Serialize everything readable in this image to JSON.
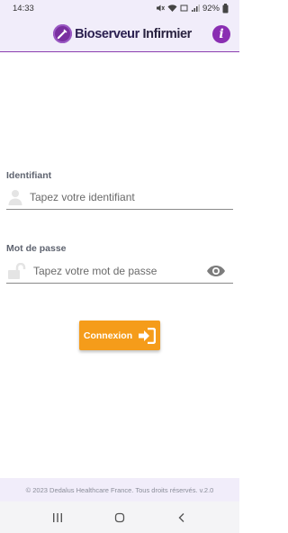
{
  "status_bar": {
    "time": "14:33",
    "battery": "92%",
    "icons": [
      "mute-icon",
      "wifi-icon",
      "volte-icon",
      "signal-icon",
      "battery-icon"
    ]
  },
  "header": {
    "brand_first": "Bioserveur",
    "brand_second": " Infirmier",
    "logo_icon": "syringe-logo-icon",
    "info_label": "i",
    "accent_color": "#8a2eb2"
  },
  "form": {
    "username_label": "Identifiant",
    "username_placeholder": "Tapez votre identifiant",
    "username_value": "",
    "password_label": "Mot de passe",
    "password_placeholder": "Tapez votre mot de passe",
    "password_value": "",
    "login_label": "Connexion",
    "login_color": "#f59c1a"
  },
  "footer": {
    "copyright": "© 2023 Dedalus Healthcare France. Tous droits réservés. v.2.0"
  },
  "nav": {
    "icons": [
      "recents-icon",
      "home-icon",
      "back-icon"
    ]
  }
}
